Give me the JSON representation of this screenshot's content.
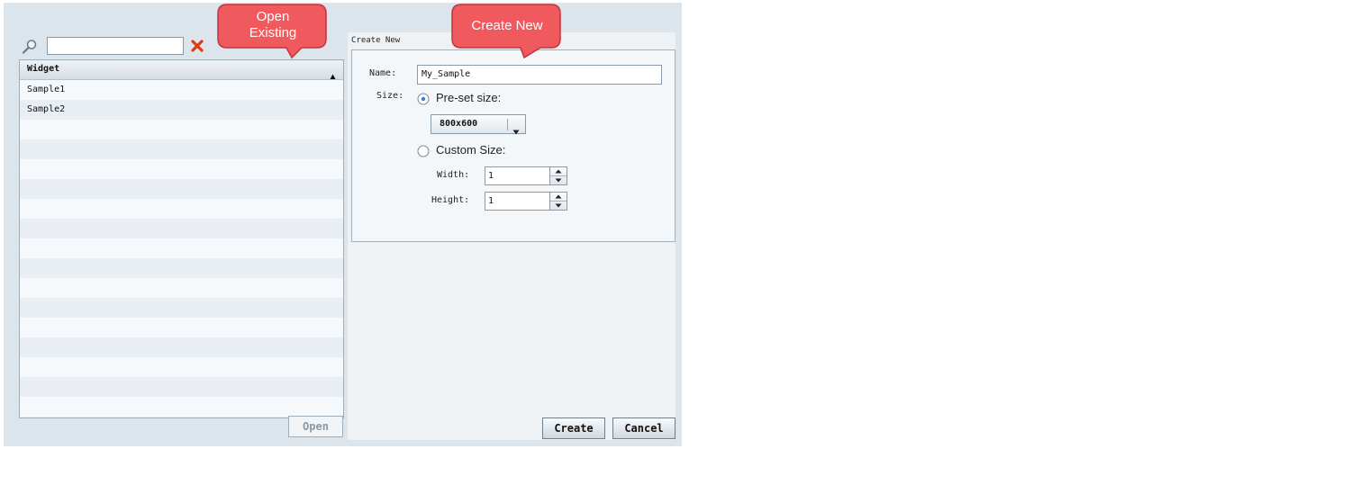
{
  "search": {
    "value": "",
    "icon": "search-icon",
    "clear_icon": "close-icon"
  },
  "widget_list": {
    "column_header": "Widget",
    "sort_icon": "sort-ascending-icon",
    "rows": [
      "Sample1",
      "Sample2"
    ]
  },
  "open_button": {
    "label": "Open",
    "enabled": false
  },
  "create_new": {
    "title": "Create New",
    "name_label": "Name:",
    "name_value": "My_Sample",
    "size_label": "Size:",
    "preset": {
      "label": "Pre-set size:",
      "selected": true,
      "value": "800x600"
    },
    "custom": {
      "label": "Custom Size:",
      "selected": false,
      "width_label": "Width:",
      "width_value": "1",
      "height_label": "Height:",
      "height_value": "1"
    }
  },
  "buttons": {
    "create": "Create",
    "cancel": "Cancel"
  },
  "callouts": {
    "open_existing_line1": "Open",
    "open_existing_line2": "Existing",
    "create_new": "Create New"
  },
  "colors": {
    "callout_fill": "#f05a5f",
    "callout_border": "#c0353a",
    "clear_icon": "#e03a10",
    "radio_selected": "#3a7fd0"
  }
}
